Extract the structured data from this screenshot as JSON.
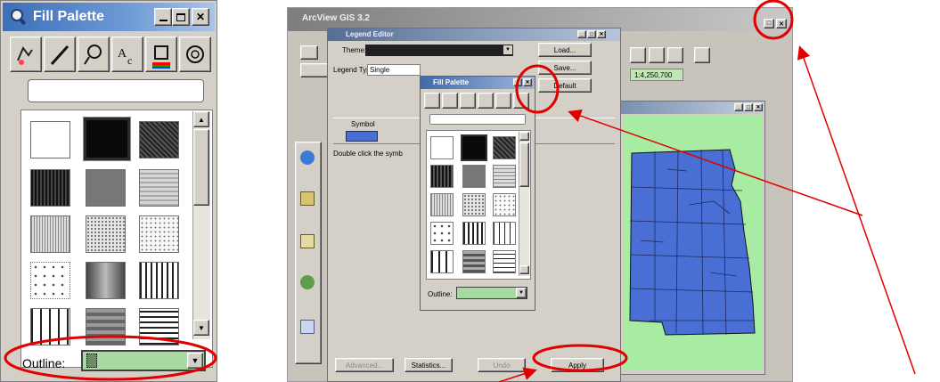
{
  "fill_palette": {
    "title": "Fill Palette",
    "outline_label": "Outline:",
    "tools": [
      "fill-icon",
      "line-icon",
      "marker-icon",
      "text-icon",
      "color-icon",
      "palette-icon"
    ]
  },
  "window": {
    "title": "ArcView GIS 3.2",
    "legend_editor": {
      "title": "Legend Editor",
      "theme_label": "Theme:",
      "legend_type_label": "Legend Type:",
      "legend_type_value": "Single",
      "symbol_header": "Symbol",
      "hint": "Double click the symb",
      "buttons": {
        "load": "Load...",
        "save": "Save...",
        "default": "Default",
        "advanced": "Advanced...",
        "statistics": "Statistics...",
        "undo": "Undo",
        "apply": "Apply"
      }
    },
    "mini_palette": {
      "title": "Fill Palette",
      "outline_label": "Outline:"
    },
    "scale": "1:4,250,700"
  },
  "colors": {
    "map_fill": "#4a6fd4",
    "map_background": "#a8eba3",
    "annotation": "#e00000",
    "outline_field": "#a7d9a0"
  }
}
